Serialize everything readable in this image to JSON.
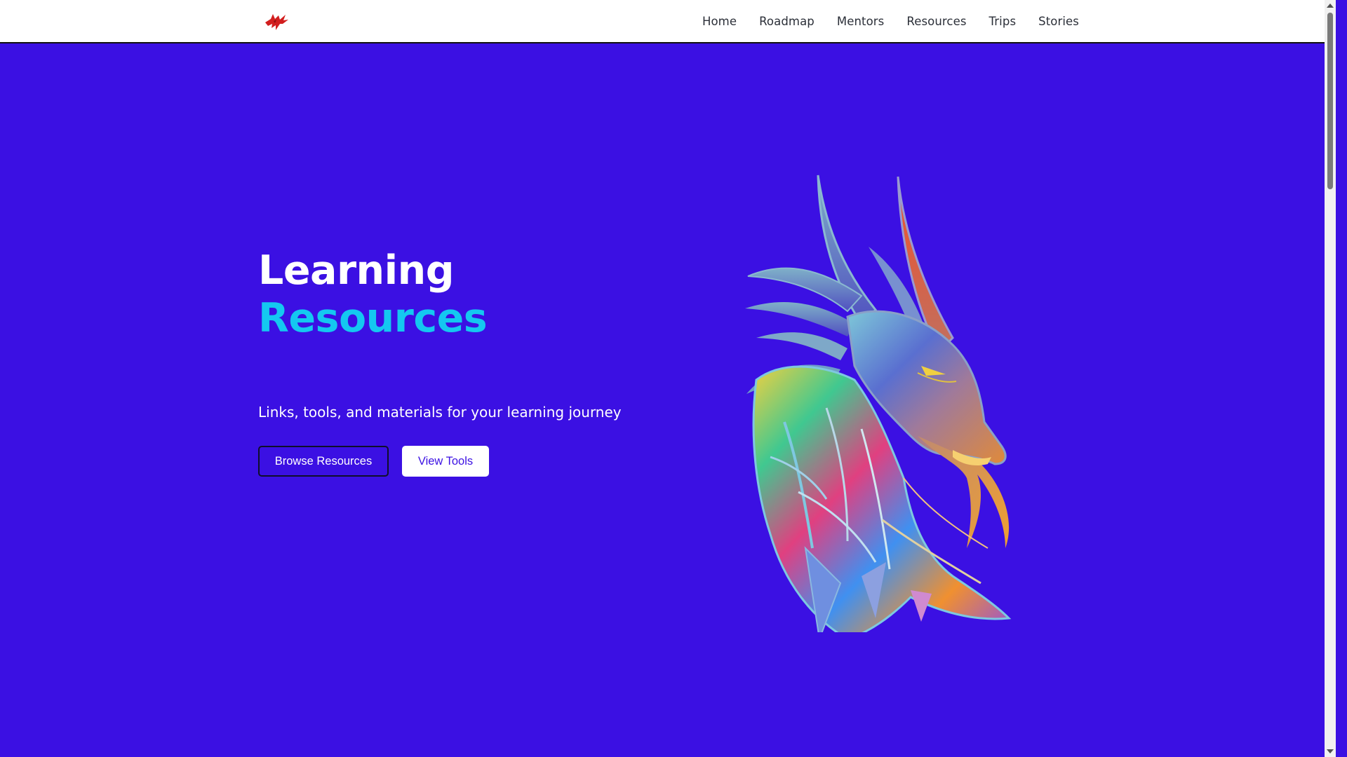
{
  "header": {
    "logo_icon": "red-phoenix-logo-icon",
    "nav": [
      {
        "label": "Home"
      },
      {
        "label": "Roadmap"
      },
      {
        "label": "Mentors"
      },
      {
        "label": "Resources"
      },
      {
        "label": "Trips"
      },
      {
        "label": "Stories"
      }
    ]
  },
  "hero": {
    "title_line1": "Learning",
    "title_line2": "Resources",
    "subtitle": "Links, tools, and materials for your learning journey",
    "primary_button": "Browse Resources",
    "secondary_button": "View Tools",
    "illustration_icon": "rainbow-dragon-head-icon"
  },
  "colors": {
    "hero_background": "#3b10e3",
    "accent_cyan": "#14c8f0",
    "header_background": "#ffffff",
    "logo_red": "#d21e1e"
  }
}
